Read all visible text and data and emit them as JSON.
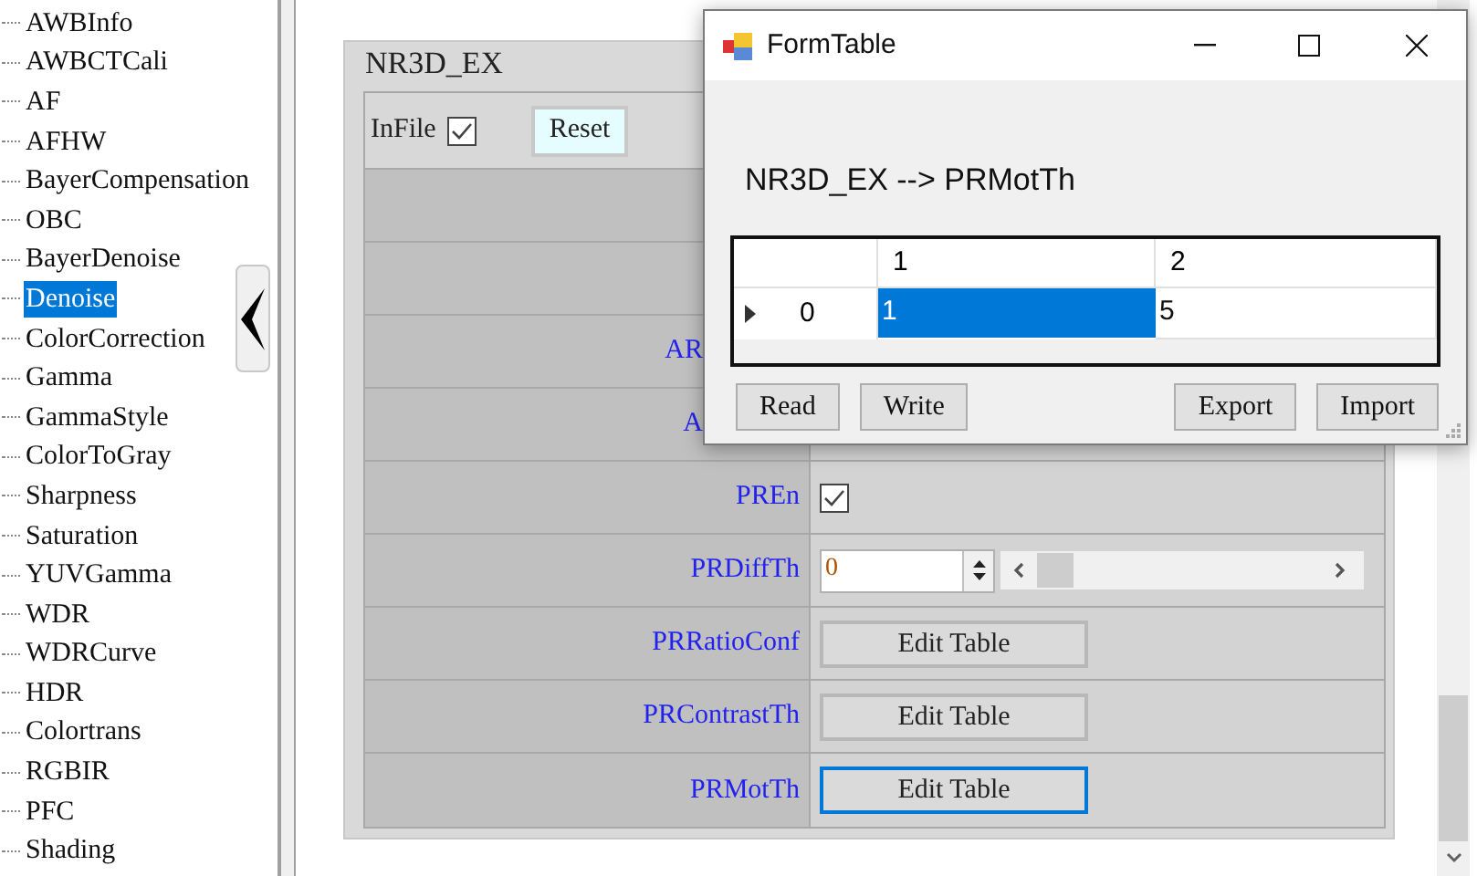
{
  "tree": {
    "items": [
      {
        "label": "AWBInfo",
        "selected": false
      },
      {
        "label": "AWBCTCali",
        "selected": false
      },
      {
        "label": "AF",
        "selected": false
      },
      {
        "label": "AFHW",
        "selected": false
      },
      {
        "label": "BayerCompensation",
        "selected": false
      },
      {
        "label": "OBC",
        "selected": false
      },
      {
        "label": "BayerDenoise",
        "selected": false
      },
      {
        "label": "Denoise",
        "selected": true
      },
      {
        "label": "ColorCorrection",
        "selected": false
      },
      {
        "label": "Gamma",
        "selected": false
      },
      {
        "label": "GammaStyle",
        "selected": false
      },
      {
        "label": "ColorToGray",
        "selected": false
      },
      {
        "label": "Sharpness",
        "selected": false
      },
      {
        "label": "Saturation",
        "selected": false
      },
      {
        "label": "YUVGamma",
        "selected": false
      },
      {
        "label": "WDR",
        "selected": false
      },
      {
        "label": "WDRCurve",
        "selected": false
      },
      {
        "label": "HDR",
        "selected": false
      },
      {
        "label": "Colortrans",
        "selected": false
      },
      {
        "label": "RGBIR",
        "selected": false
      },
      {
        "label": "PFC",
        "selected": false
      },
      {
        "label": "Shading",
        "selected": false
      }
    ]
  },
  "panel": {
    "title": "NR3D_EX",
    "infile": {
      "label": "InFile",
      "checked": true
    },
    "reset_button": "Reset",
    "rows": [
      {
        "kind": "blank"
      },
      {
        "kind": "blank"
      },
      {
        "kind": "label",
        "label": "AR"
      },
      {
        "kind": "label",
        "label": "A"
      },
      {
        "kind": "checkbox",
        "label": "PREn",
        "checked": true
      },
      {
        "kind": "spin",
        "label": "PRDiffTh",
        "value": "0"
      },
      {
        "kind": "button",
        "label": "PRRatioConf",
        "button": "Edit Table",
        "focused": false
      },
      {
        "kind": "button",
        "label": "PRContrastTh",
        "button": "Edit Table",
        "focused": false
      },
      {
        "kind": "button",
        "label": "PRMotTh",
        "button": "Edit Table",
        "focused": true
      }
    ]
  },
  "dialog": {
    "title": "FormTable",
    "heading": "NR3D_EX --> PRMotTh",
    "table": {
      "columns": [
        "1",
        "2"
      ],
      "rows": [
        {
          "header": "0",
          "current": true,
          "cells": [
            {
              "text": "1",
              "selected": true
            },
            {
              "text": "5",
              "selected": false
            }
          ]
        }
      ]
    },
    "left_buttons": [
      "Read",
      "Write"
    ],
    "right_buttons": [
      "Export",
      "Import"
    ]
  }
}
